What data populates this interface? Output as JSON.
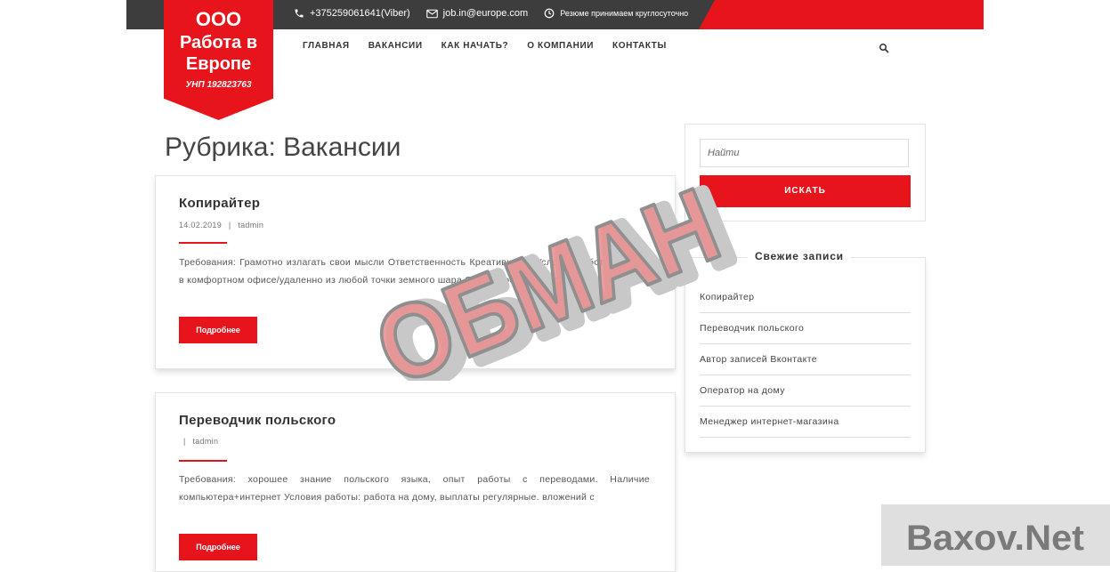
{
  "header": {
    "phone": "+375259061641(Viber)",
    "email": "job.in@europe.com",
    "hours": "Резюме принимаем круглосуточно"
  },
  "logo": {
    "line1": "ООО",
    "line2": "Работа в",
    "line3": "Европе",
    "unp": "УНП 192823763"
  },
  "nav": {
    "items": [
      "ГЛАВНАЯ",
      "ВАКАНСИИ",
      "КАК НАЧАТЬ?",
      "О КОМПАНИИ",
      "КОНТАКТЫ"
    ]
  },
  "page": {
    "title": "Рубрика: Вакансии"
  },
  "posts": [
    {
      "title": "Копирайтер",
      "date": "14.02.2019",
      "separator": "|",
      "author": "tadmin",
      "excerpt": "Требования: Грамотно излагать свои мысли Ответственность Креативность Условия работы: Работа в комфортном офисе/удаленно из любой точки земного шара Обязанности: Написание",
      "more_label": "Подробнее"
    },
    {
      "title": "Переводчик польского",
      "date": "",
      "separator": "|",
      "author": "tadmin",
      "excerpt": "Требования: хорошее знание польского языка, опыт работы с переводами. Наличие компьютера+интернет Условия работы: работа на дому, выплаты регулярные. вложений с",
      "more_label": "Подробнее"
    }
  ],
  "sidebar": {
    "search_placeholder": "Найти",
    "search_button": "ИСКАТЬ",
    "recent_title": "Свежие записи",
    "recent": [
      "Копирайтер",
      "Переводчик польского",
      "Автор записей Вконтакте",
      "Оператор на дому",
      "Менеджер интернет-магазина"
    ]
  },
  "overlay": {
    "stamp_text": "ОБМАН",
    "watermark_text": "Baxov.Net"
  },
  "colors": {
    "accent": "#e8141c",
    "topbar": "#3d3d3d",
    "stamp_fill": "#e89090"
  },
  "icons": [
    "phone-icon",
    "mail-icon",
    "clock-icon",
    "search-icon"
  ]
}
